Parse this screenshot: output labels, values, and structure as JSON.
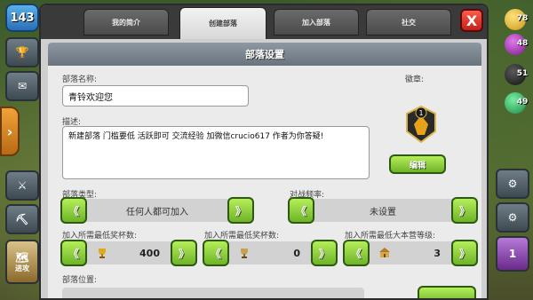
{
  "hud": {
    "level": "143",
    "attack_label": "进攻",
    "resources": [
      "78",
      "48",
      "51",
      "49"
    ],
    "notice_count": "1"
  },
  "tabs": [
    {
      "label": "我的简介"
    },
    {
      "label": "创建部落",
      "active": true
    },
    {
      "label": "加入部落"
    },
    {
      "label": "社交"
    }
  ],
  "close_label": "X",
  "panel": {
    "title": "部落设置",
    "name_label": "部落名称:",
    "name_value": "青铃欢迎您",
    "desc_label": "描述:",
    "desc_value": "新建部落 门槛要低 活跃即可 交流经验 加微信crucio617 作者为你答疑!",
    "badge_label": "徽章:",
    "badge_level": "1",
    "edit_label": "编辑",
    "type_label": "部落类型:",
    "type_value": "任何人都可加入",
    "war_label": "对战频率:",
    "war_value": "未设置",
    "trophy_label": "加入所需最低奖杯数:",
    "trophy_value": "400",
    "builder_trophy_label": "加入所需最低奖杯数:",
    "builder_trophy_value": "0",
    "th_label": "加入所需最低大本营等级:",
    "th_value": "3",
    "location_label": "部落位置:",
    "arrow_left": "《",
    "arrow_right": "》"
  },
  "colors": {
    "accent_green": "#8ed23c",
    "close_red": "#e0372a",
    "title_bar": "#7b858f"
  }
}
